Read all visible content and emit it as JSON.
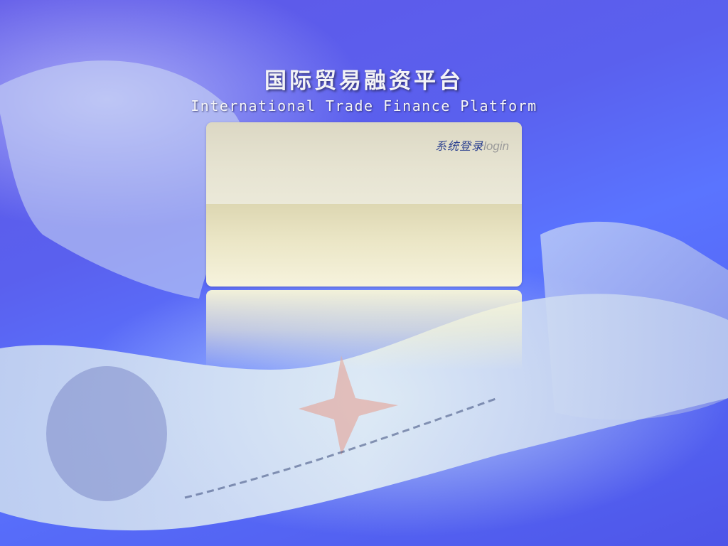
{
  "header": {
    "title_cn": "国际贸易融资平台",
    "title_en": "International Trade Finance Platform"
  },
  "login_panel": {
    "label_cn": "系统登录",
    "label_en": "login"
  },
  "background": {
    "image": "check-and-banknote-photo",
    "colors": {
      "base": "#5a60ee",
      "accent": "#2a3f8f"
    }
  }
}
